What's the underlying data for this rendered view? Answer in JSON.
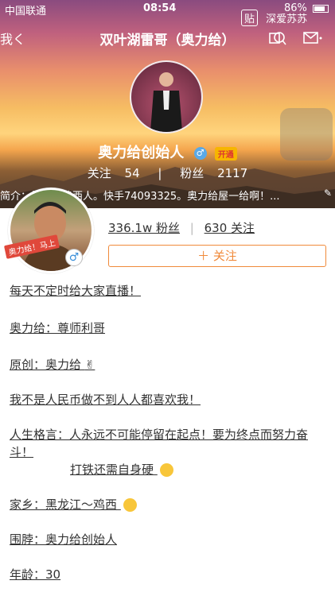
{
  "status_bar": {
    "carrier": "中国联通",
    "time": "08:54",
    "battery": "86%"
  },
  "floating_widget": {
    "badge": "贴",
    "label": "深爱苏苏"
  },
  "nav": {
    "back_label": "我く",
    "title": "双叶湖雷哥（奥力给）"
  },
  "header": {
    "name": "奥力给创始人",
    "male_symbol": "♂",
    "vip_badge": "开通",
    "follow_label": "关注",
    "follow_count": "54",
    "divider": "|",
    "fans_label": "粉丝",
    "fans_count": "2117",
    "bio": "简介：黑龙江鸡西人。快手74093325。奥力给屋一给啊！..."
  },
  "profile": {
    "avatar_ribbon": "奥力给！马上",
    "male_symbol": "♂",
    "fans": "336.1w 粉丝",
    "following": "630 关注",
    "follow_button": "＋ 关注"
  },
  "bio_lines": [
    "每天不定时给大家直播！",
    "奥力给：尊师利哥",
    "原创：奥力给",
    "我不是人民币做不到人人都喜欢我！",
    "人生格言：人永远不可能停留在起点！要为终点而努力奋",
    "斗！",
    "打铁还需自身硬",
    "家乡：黑龙江～鸡西",
    "围脖：奥力给创始人",
    "年龄：30"
  ]
}
